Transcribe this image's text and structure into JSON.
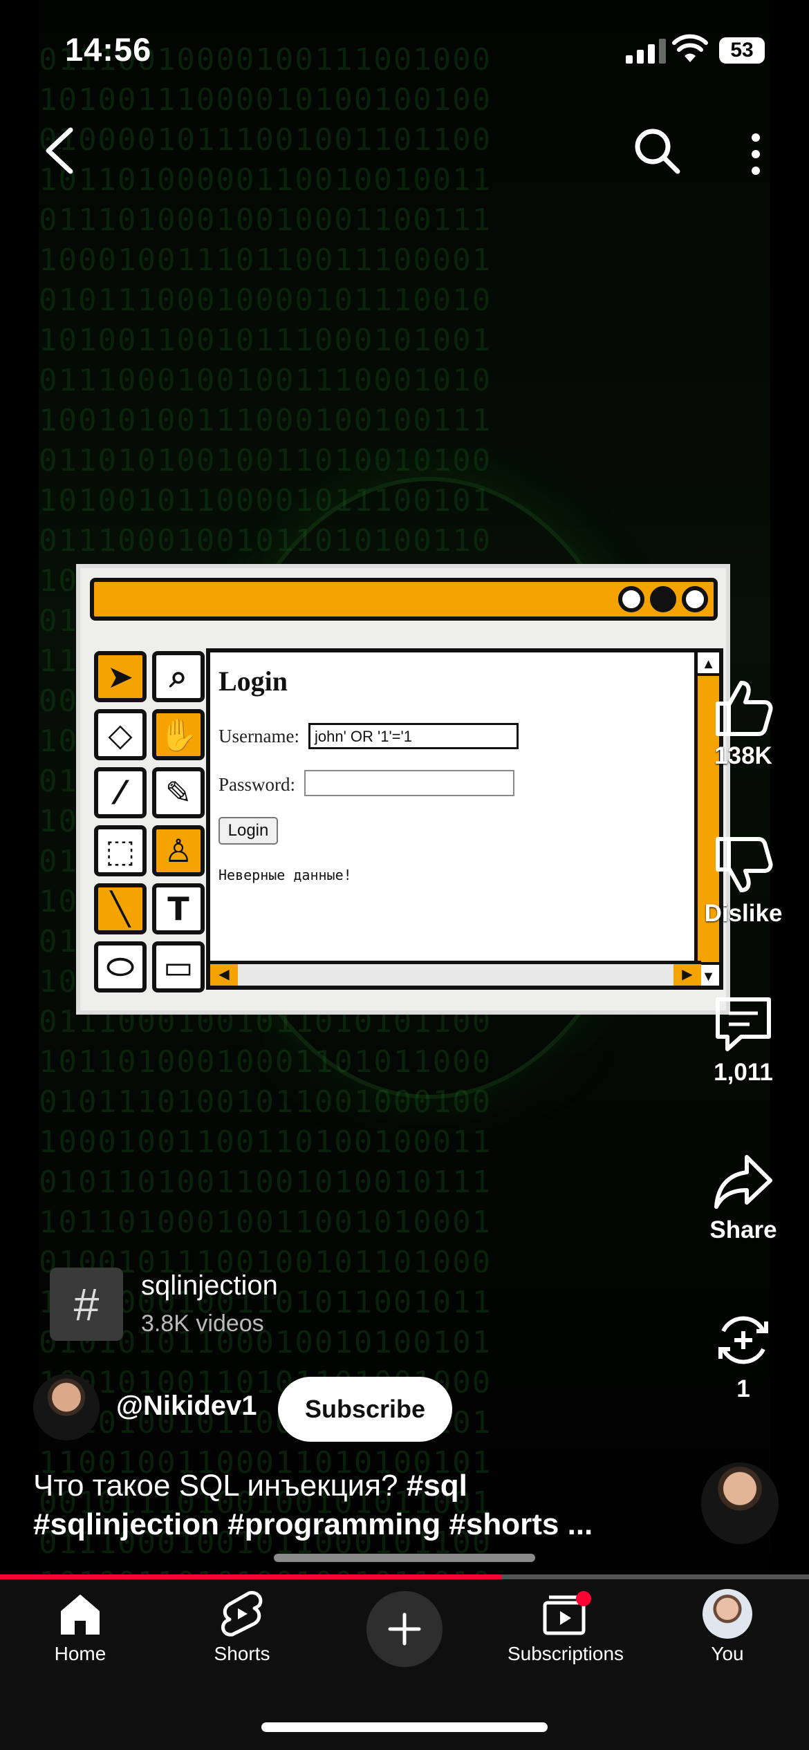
{
  "status": {
    "time": "14:56",
    "battery": "53"
  },
  "topbar": {
    "back_icon": "chevron-left-icon",
    "search_icon": "search-icon",
    "more_icon": "more-vertical-icon"
  },
  "video_frame": {
    "login_title": "Login",
    "username_label": "Username:",
    "username_value": "john' OR '1'='1",
    "password_label": "Password:",
    "login_button": "Login",
    "error_text": "Неверные данные!"
  },
  "actions": {
    "like_count": "138K",
    "dislike_label": "Dislike",
    "comment_count": "1,011",
    "share_label": "Share",
    "remix_count": "1"
  },
  "hashtag": {
    "symbol": "#",
    "name": "sqlinjection",
    "count": "3.8K videos"
  },
  "channel": {
    "handle": "@Nikidev1",
    "subscribe_label": "Subscribe"
  },
  "caption": {
    "line1_text": "Что такое SQL инъекция? ",
    "line1_tag": "#sql",
    "line2": "#sqlinjection #programming #shorts ..."
  },
  "progress": {
    "fraction": 0.62
  },
  "nav": {
    "items": [
      {
        "label": "Home",
        "icon": "home-icon"
      },
      {
        "label": "Shorts",
        "icon": "shorts-icon"
      },
      {
        "label": "Subscriptions",
        "icon": "subscriptions-icon"
      },
      {
        "label": "You",
        "icon": "avatar"
      }
    ],
    "create_icon": "plus-icon"
  },
  "colors": {
    "accent": "#ff0033",
    "window_orange": "#f4a300"
  }
}
